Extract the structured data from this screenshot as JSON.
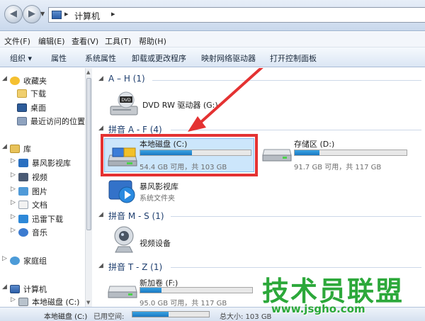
{
  "address": {
    "crumbs": [
      "计算机"
    ],
    "separator": "▸"
  },
  "menu": [
    "文件(F)",
    "编辑(E)",
    "查看(V)",
    "工具(T)",
    "帮助(H)"
  ],
  "toolbar": {
    "organize": "组织 ▾",
    "properties": "属性",
    "system_properties": "系统属性",
    "uninstall": "卸载或更改程序",
    "map_drive": "映射网络驱动器",
    "control_panel": "打开控制面板"
  },
  "nav": {
    "favorites": "收藏夹",
    "downloads": "下载",
    "desktop": "桌面",
    "recent": "最近访问的位置",
    "libraries": "库",
    "baofeng": "暴风影视库",
    "videos": "视频",
    "pictures": "图片",
    "documents": "文档",
    "thunder": "迅雷下载",
    "music": "音乐",
    "homegroup": "家庭组",
    "computer": "计算机",
    "local_c": "本地磁盘 (C:)"
  },
  "groups": {
    "ah": "A – H (1)",
    "af": "拼音 A - F (4)",
    "ms": "拼音 M - S (1)",
    "tz": "拼音 T - Z (1)"
  },
  "drives": {
    "dvd": {
      "name": "DVD RW 驱动器 (G:)"
    },
    "c": {
      "name": "本地磁盘 (C:)",
      "info": "54.4 GB 可用，共 103 GB",
      "used_fraction": 0.47
    },
    "d": {
      "name": "存储区 (D:)",
      "info": "91.7 GB 可用，共 117 GB",
      "used_fraction": 0.22
    },
    "baofeng": {
      "name": "暴风影视库",
      "sub": "系统文件夹"
    },
    "webcam": {
      "name": "视频设备"
    },
    "f": {
      "name": "新加卷 (F:)",
      "info": "95.0 GB 可用，共 117 GB",
      "used_fraction": 0.19
    }
  },
  "status": {
    "name": "本地磁盘 (C:)",
    "used_label": "已用空间:",
    "used_fraction": 0.47,
    "total": "总大小: 103 GB"
  },
  "watermark": {
    "title": "技术员联盟",
    "url": "www.jsgho.com"
  },
  "colors": {
    "accent": "#1a78c2",
    "highlight": "#e43232",
    "watermark": "#2ca83a"
  }
}
